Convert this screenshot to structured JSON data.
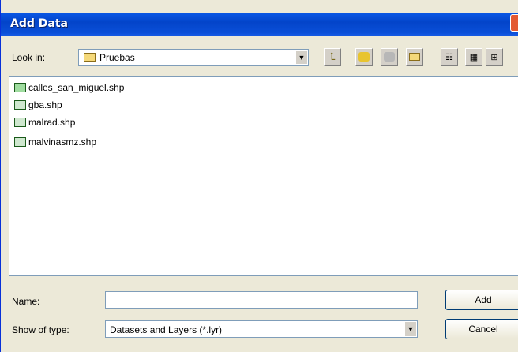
{
  "window": {
    "title": "Add Data"
  },
  "look_in": {
    "label": "Look in:",
    "value": "Pruebas"
  },
  "files": [
    {
      "name": "calles_san_miguel.shp",
      "icon": "line-shapefile-icon"
    },
    {
      "name": "gba.shp",
      "icon": "polygon-shapefile-icon"
    },
    {
      "name": "malrad.shp",
      "icon": "polygon-shapefile-icon"
    },
    {
      "name": "malvinasmz.shp",
      "icon": "polygon-shapefile-icon"
    }
  ],
  "name_field": {
    "label": "Name:",
    "value": ""
  },
  "type_field": {
    "label": "Show of type:",
    "value": "Datasets and Layers (*.lyr)"
  },
  "buttons": {
    "add": "Add",
    "cancel": "Cancel"
  },
  "colors": {
    "titlebar": "#0a58e6",
    "face": "#ece9d8",
    "border": "#7f9db9"
  }
}
